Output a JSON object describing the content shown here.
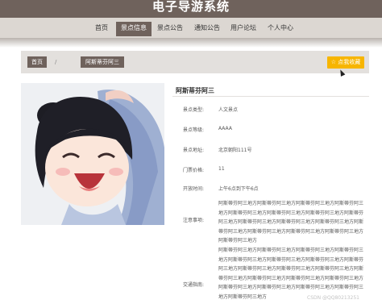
{
  "header": {
    "title": "电子导游系统"
  },
  "nav": {
    "items": [
      {
        "label": "首页"
      },
      {
        "label": "景点信息",
        "active": true
      },
      {
        "label": "景点公告"
      },
      {
        "label": "通知公告"
      },
      {
        "label": "用户论坛"
      },
      {
        "label": "个人中心"
      }
    ]
  },
  "breadcrumb": {
    "home": "首页",
    "current": "阿斯蒂芬阿三"
  },
  "actions": {
    "favorite": "☆ 点我收藏"
  },
  "detail": {
    "title": "阿斯蒂芬阿三",
    "rows": [
      {
        "label": "景点类型:",
        "value": "人文景点"
      },
      {
        "label": "景点等级:",
        "value": "AAAA"
      },
      {
        "label": "景点地址:",
        "value": "北京朝阳111号"
      },
      {
        "label": "门票价格:",
        "value": "11"
      },
      {
        "label": "开放时间:",
        "value": "上午6点到下午6点"
      },
      {
        "label": "注意事项:",
        "value": "阿斯蒂芬阿三地方阿斯蒂芬阿三地方阿斯蒂芬阿三地方阿斯蒂芬阿三地方阿斯蒂芬阿三地方阿斯蒂芬阿三地方阿斯蒂芬阿三地方阿斯蒂芬阿三地方阿斯蒂芬阿三地方阿斯蒂芬阿三地方阿斯蒂芬阿三地方阿斯蒂芬阿三地方阿斯蒂芬阿三地方阿斯蒂芬阿三地方阿斯蒂芬阿三地方阿斯蒂芬阿三地方"
      },
      {
        "label": "交通指南:",
        "value": "阿斯蒂芬阿三地方阿斯蒂芬阿三地方阿斯蒂芬阿三地方阿斯蒂芬阿三地方阿斯蒂芬阿三地方阿斯蒂芬阿三地方阿斯蒂芬阿三地方阿斯蒂芬阿三地方阿斯蒂芬阿三地方阿斯蒂芬阿三地方阿斯蒂芬阿三地方阿斯蒂芬阿三地方阿斯蒂芬阿三地方阿斯蒂芬阿三地方阿斯蒂芬阿三地方阿斯蒂芬阿三地方阿斯蒂芬阿三地方阿斯蒂芬阿三地方阿斯蒂芬阿三地方阿斯蒂芬阿三地方"
      }
    ]
  },
  "watermark": "CSDN @QQ80213251",
  "colors": {
    "brand": "#6f625c",
    "navbar": "#dcd7d2",
    "favorite": "#f7b500"
  }
}
